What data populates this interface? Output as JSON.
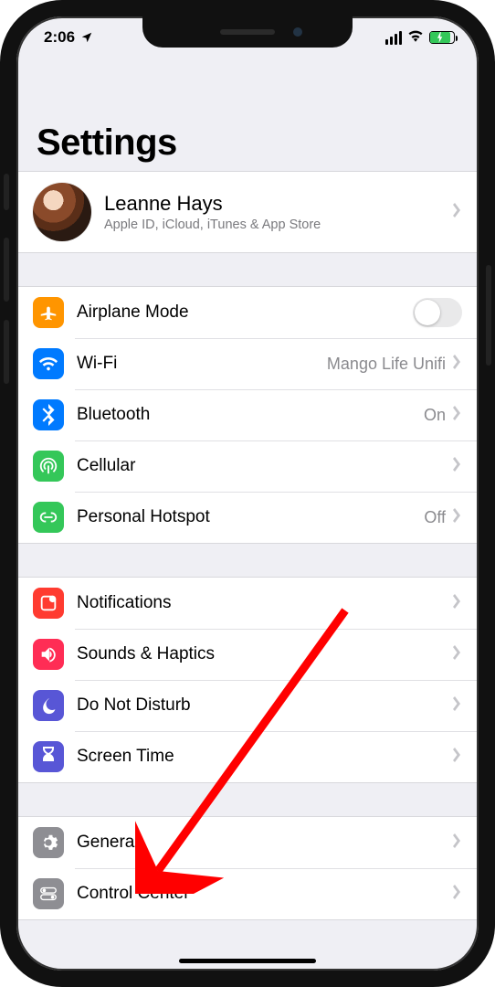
{
  "status": {
    "time": "2:06",
    "location_icon": "location-arrow-icon",
    "signal_label": "cellular-signal",
    "wifi_label": "wifi-icon",
    "battery_label": "battery-charging-icon"
  },
  "title": "Settings",
  "profile": {
    "name": "Leanne Hays",
    "subtitle": "Apple ID, iCloud, iTunes & App Store"
  },
  "colors": {
    "orange": "#ff9500",
    "blue": "#007aff",
    "green": "#34c759",
    "red": "#ff3b30",
    "pink": "#ff2d55",
    "indigo": "#5856d6",
    "gray": "#8e8e93"
  },
  "group1": {
    "airplane": {
      "label": "Airplane Mode",
      "on": false
    },
    "wifi": {
      "label": "Wi-Fi",
      "value": "Mango Life Unifi"
    },
    "bluetooth": {
      "label": "Bluetooth",
      "value": "On"
    },
    "cellular": {
      "label": "Cellular"
    },
    "hotspot": {
      "label": "Personal Hotspot",
      "value": "Off"
    }
  },
  "group2": {
    "notifications": {
      "label": "Notifications"
    },
    "sounds": {
      "label": "Sounds & Haptics"
    },
    "dnd": {
      "label": "Do Not Disturb"
    },
    "screentime": {
      "label": "Screen Time"
    }
  },
  "group3": {
    "general": {
      "label": "General"
    },
    "controlcenter": {
      "label": "Control Center"
    }
  },
  "annotation": {
    "type": "arrow",
    "target": "general-row",
    "color": "#ff0000"
  }
}
